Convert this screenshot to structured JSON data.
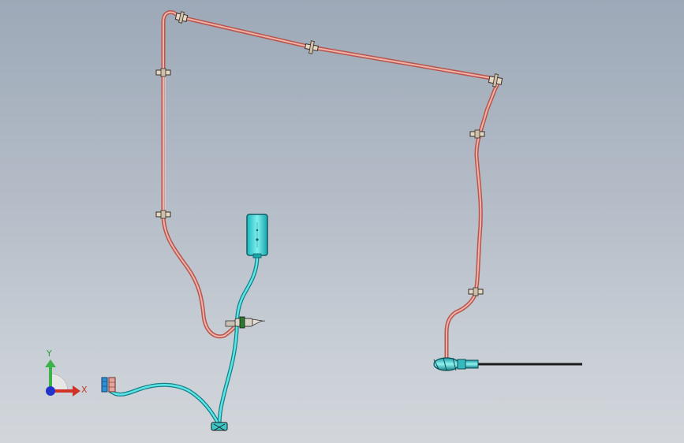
{
  "viewport": {
    "background_top": "#9da9b8",
    "background_bottom": "#d2d6db"
  },
  "colors": {
    "pink_tube": "#e8968c",
    "pink_tube_dark": "#b8544c",
    "cyan_tube": "#3fd6d6",
    "cyan_tube_dark": "#138f96",
    "probe": "#1c1c1c",
    "clip": "#d7c9b8"
  },
  "triad": {
    "x_label": "X",
    "y_label": "Y",
    "x_color": "#d0322a",
    "y_color": "#3cb34a",
    "origin_color": "#2233cc"
  },
  "components": {
    "sensor_box": "cyan-sensor-box",
    "connector": "connector-plug",
    "fitting": "inline-fitting",
    "probe": "probe-rod",
    "clips": "tube-clip"
  }
}
